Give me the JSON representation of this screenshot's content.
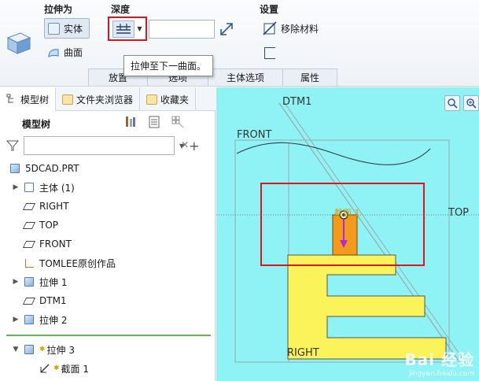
{
  "ribbon": {
    "extrude_as_label": "拉伸为",
    "solid_label": "实体",
    "surface_label": "曲面",
    "depth_label": "深度",
    "depth_value": "",
    "settings_label": "设置",
    "remove_material_label": "移除材料",
    "tooltip": "拉伸至下一曲面。",
    "tabs": [
      "放置",
      "选项",
      "主体选项",
      "属性"
    ]
  },
  "panel": {
    "tabs": [
      {
        "label": "模型树",
        "icon": "model-tree-icon"
      },
      {
        "label": "文件夹浏览器",
        "icon": "folder-browser-icon"
      },
      {
        "label": "收藏夹",
        "icon": "favorites-icon"
      }
    ],
    "header": "模型树",
    "filter_value": "",
    "items": [
      {
        "label": "5DCAD.PRT",
        "icon": "part-icon",
        "expander": "",
        "indent": 0
      },
      {
        "label": "主体 (1)",
        "icon": "body-icon",
        "expander": "▶",
        "indent": 1
      },
      {
        "label": "RIGHT",
        "icon": "datum-plane-icon",
        "expander": "",
        "indent": 1
      },
      {
        "label": "TOP",
        "icon": "datum-plane-icon",
        "expander": "",
        "indent": 1
      },
      {
        "label": "FRONT",
        "icon": "datum-plane-icon",
        "expander": "",
        "indent": 1
      },
      {
        "label": "TOMLEE原创作品",
        "icon": "coordinate-system-icon",
        "expander": "",
        "indent": 1
      },
      {
        "label": "拉伸 1",
        "icon": "extrude-icon",
        "expander": "▶",
        "indent": 1
      },
      {
        "label": "DTM1",
        "icon": "datum-plane-icon",
        "expander": "",
        "indent": 1
      },
      {
        "label": "拉伸 2",
        "icon": "extrude-icon",
        "expander": "▶",
        "indent": 1
      },
      {
        "label": "拉伸 3",
        "icon": "extrude-icon",
        "expander": "▼",
        "indent": 1,
        "new": true
      },
      {
        "label": "截面 1",
        "icon": "sketch-icon",
        "expander": "",
        "indent": 2,
        "new": true
      }
    ]
  },
  "graphics": {
    "datum_labels": {
      "dtm1": "DTM1",
      "front": "FRONT",
      "top": "TOP",
      "right": "RIGHT"
    },
    "section_label": "截面 1",
    "colors": {
      "background": "#8ff3f6",
      "part": "#fbf35a",
      "section": "#f39a1c",
      "highlight": "#e0141e",
      "arrow": "#b02ad6"
    }
  },
  "watermark": {
    "brand": "Bai 经验",
    "url": "jingyan.baidu.com"
  }
}
